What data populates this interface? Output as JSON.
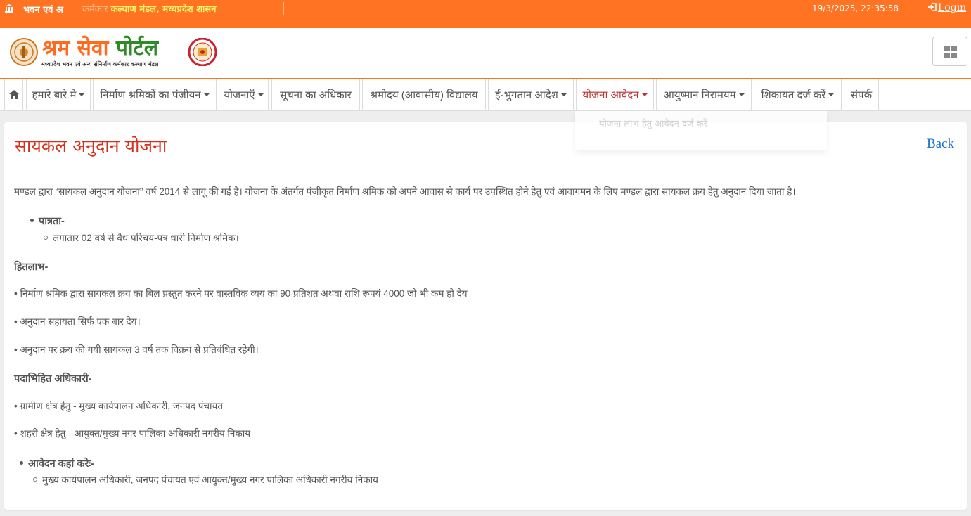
{
  "topbar": {
    "ticker_lead": "भवन एवं अ",
    "ticker_faded": "कर्मकार",
    "ticker_highlight": "कल्याण मंडल, मध्यप्रदेश शासन",
    "datetime": "19/3/2025, 22:35:58",
    "login_label": "Login"
  },
  "header": {
    "brand_part1": "श्रम सेवा",
    "brand_part2": "पोर्टल",
    "subtitle": "मध्यप्रदेश भवन एवं अन्य संनिर्माण कर्मकार कल्याण मंडल"
  },
  "nav": {
    "items": [
      {
        "label": "हमारे बारे मे",
        "caret": true
      },
      {
        "label": "निर्माण श्रमिकों का पंजीयन",
        "caret": true
      },
      {
        "label": "योजनाएँ",
        "caret": true
      },
      {
        "label": "सूचना का अधिकार",
        "caret": false
      },
      {
        "label": "श्रमोदय (आवासीय) विद्यालय",
        "caret": false
      },
      {
        "label": "ई-भुगतान आदेश",
        "caret": true
      },
      {
        "label": "योजना आवेदन",
        "caret": true
      },
      {
        "label": "आयुष्मान निरामयम",
        "caret": true
      },
      {
        "label": "शिकायत दर्ज करें",
        "caret": true
      },
      {
        "label": "संपर्क",
        "caret": false
      }
    ],
    "dropdown_item": "योजना लाभ हेतु आवेदन दर्ज करें"
  },
  "content": {
    "title": "सायकल अनुदान योजना",
    "back_label": "Back",
    "intro": "मण्डल द्वारा “सायकल अनुदान योजना” वर्ष 2014 से लागू की गई है। योजना के अंतर्गत पंजीकृत निर्माण श्रमिक को अपने आवास से कार्य पर उपस्थित होने हेतु एवं आवागमन के लिए मण्डल द्वारा सायकल क्रय हेतु अनुदान दिया जाता है।",
    "eligibility_heading": "पात्रता-",
    "eligibility_item": "लगातार 02 वर्ष से वैध परिचय-पत्र धारी निर्माण श्रमिक।",
    "benefit_heading": "हितलाभ-",
    "benefits": [
      "• निर्माण श्रमिक द्वारा सायकल क्रय का बिल प्रस्तुत करने पर वास्तविक व्यय का 90 प्रतिशत अथवा राशि रूपयं 4000 जो भी कम हो देय",
      "• अनुदान सहायता सिर्फ एक बार देय।",
      "• अनुदान पर क्रय की गयी सायकल 3 वर्ष तक विक्रय से प्रतिबंधित रहेगी।"
    ],
    "officer_heading": "पदाभिहित अधिकारी-",
    "officers": [
      "• ग्रामीण क्षेत्र हेतु - मुख्य कार्यपालन अधिकारी, जनपद पंचायत",
      "• शहरी क्षेत्र हेतु - आयुक्त/मुख्य नगर पालिका अधिकारी नगरीय निकाय"
    ],
    "apply_heading": "आवेदन कहां करेः-",
    "apply_item": "मुख्य कार्यपालन अधिकारी, जनपद पंचायत एवं आयुक्त/मुख्य नगर पालिका अधिकारी नगरीय निकाय"
  },
  "colors": {
    "accent_orange": "#ff7322",
    "title_red": "#d8301c",
    "brand_green": "#2e8b28",
    "link_blue": "#1a73c9"
  }
}
